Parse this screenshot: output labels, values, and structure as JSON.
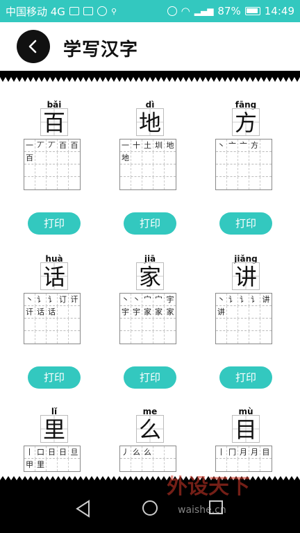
{
  "status_bar": {
    "carrier": "中国移动 4G",
    "battery": "87%",
    "time": "14:49"
  },
  "app_bar": {
    "title": "学写汉字",
    "back_icon": "chevron-left-icon"
  },
  "colors": {
    "accent": "#33c8bf",
    "back_button_bg": "#111111",
    "nav_bar_bg": "#000000"
  },
  "cards": [
    {
      "pinyin": "bǎi",
      "char": "百",
      "strokes": [
        "一",
        "丆",
        "丆",
        "百",
        "百"
      ],
      "practice": [
        "百"
      ],
      "button": "打印"
    },
    {
      "pinyin": "dì",
      "char": "地",
      "strokes": [
        "一",
        "十",
        "土",
        "圳",
        "地"
      ],
      "practice": [
        "地"
      ],
      "button": "打印"
    },
    {
      "pinyin": "fāng",
      "char": "方",
      "strokes": [
        "丶",
        "亠",
        "亠",
        "方"
      ],
      "practice": [],
      "button": "打印"
    },
    {
      "pinyin": "huà",
      "char": "话",
      "strokes": [
        "丶",
        "讠",
        "讠",
        "订",
        "讦"
      ],
      "practice": [
        "讦",
        "话",
        "话"
      ],
      "button": "打印"
    },
    {
      "pinyin": "jiā",
      "char": "家",
      "strokes": [
        "丶",
        "丶",
        "宀",
        "宀",
        "宇"
      ],
      "practice": [
        "宇",
        "宇",
        "家",
        "家",
        "家"
      ],
      "button": "打印"
    },
    {
      "pinyin": "jiǎng",
      "char": "讲",
      "strokes": [
        "丶",
        "讠",
        "讠",
        "讠",
        "讲"
      ],
      "practice": [
        "讲"
      ],
      "button": "打印"
    },
    {
      "pinyin": "lǐ",
      "char": "里",
      "strokes": [
        "丨",
        "口",
        "日",
        "日",
        "旦"
      ],
      "practice": [
        "甲",
        "里"
      ],
      "button": ""
    },
    {
      "pinyin": "me",
      "char": "么",
      "strokes": [
        "丿",
        "么",
        "么"
      ],
      "practice": [],
      "button": ""
    },
    {
      "pinyin": "mù",
      "char": "目",
      "strokes": [
        "丨",
        "冂",
        "月",
        "月",
        "目"
      ],
      "practice": [],
      "button": ""
    }
  ],
  "watermark": {
    "logo_text": "外设天下",
    "url": "waishe.cn"
  }
}
